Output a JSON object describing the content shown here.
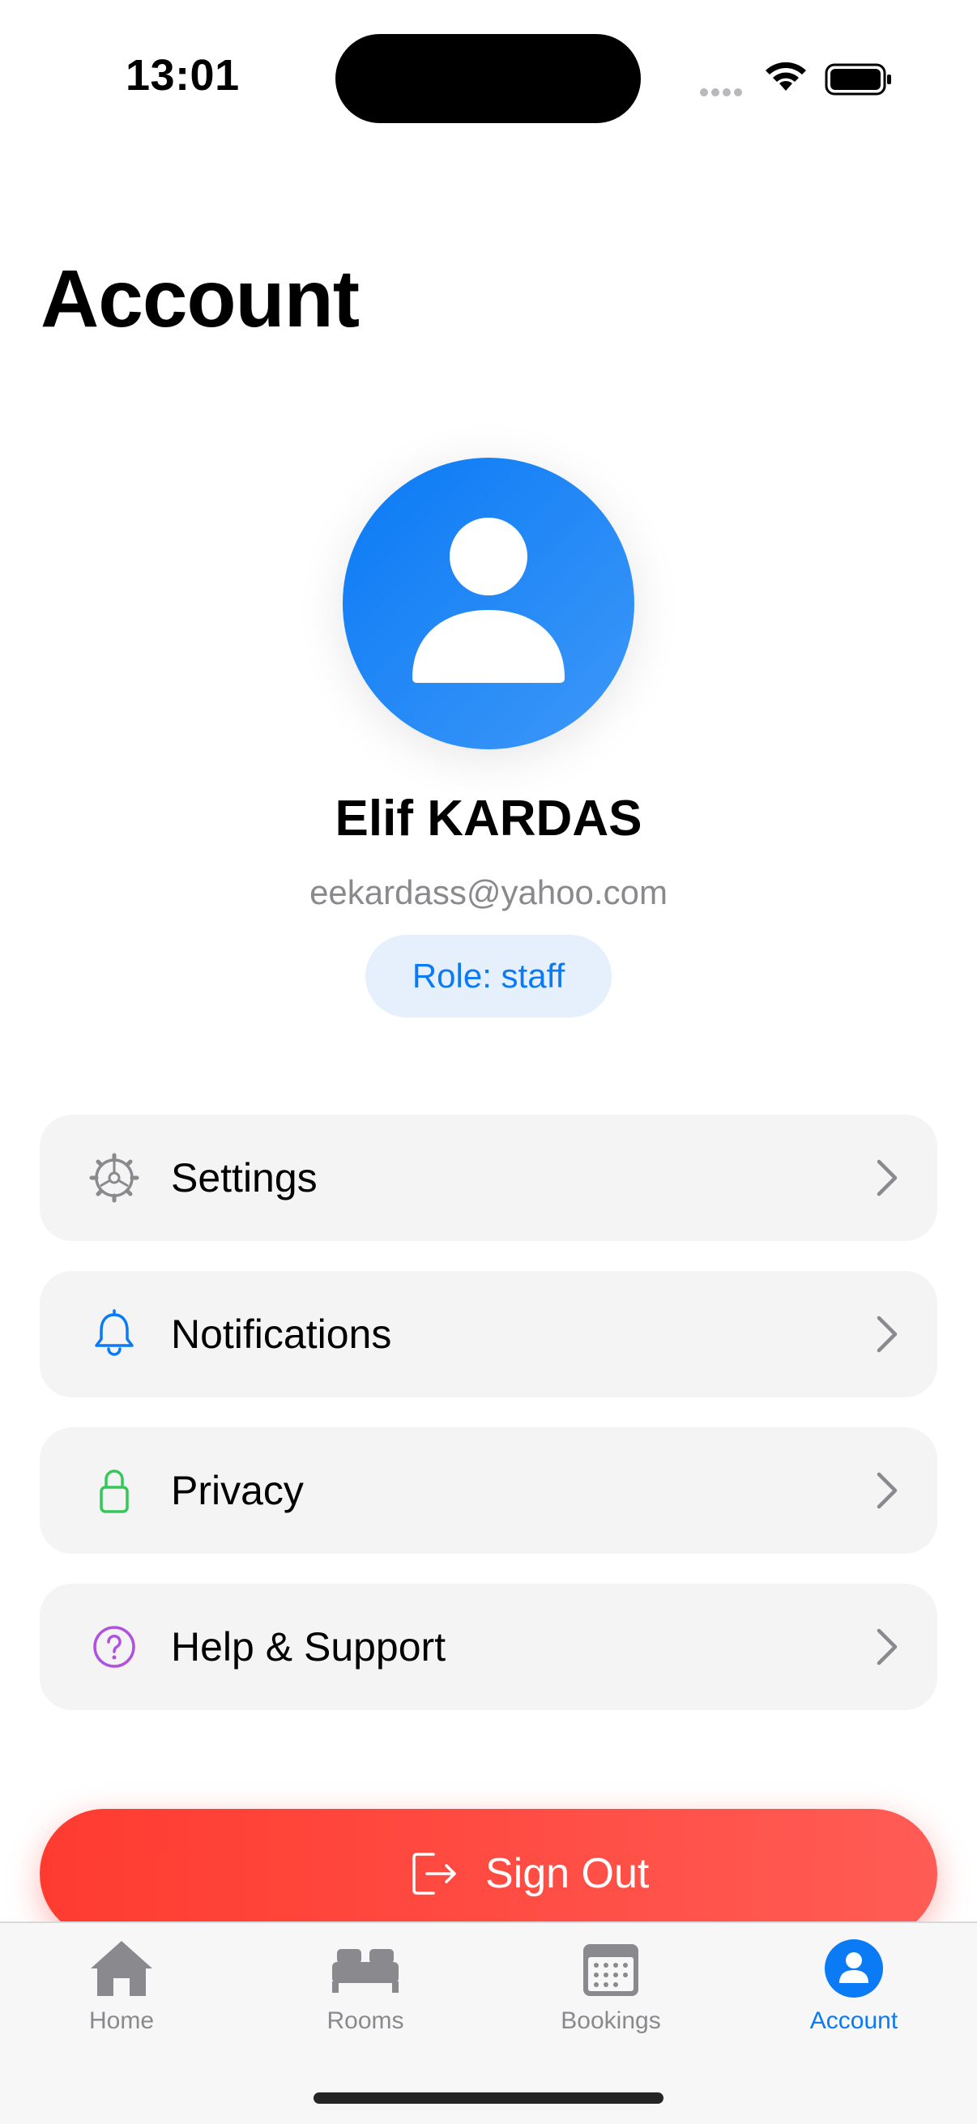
{
  "status_bar": {
    "time": "13:01"
  },
  "page": {
    "title": "Account"
  },
  "profile": {
    "name": "Elif KARDAS",
    "email": "eekardass@yahoo.com",
    "role_badge": "Role: staff"
  },
  "menu": {
    "items": [
      {
        "label": "Settings",
        "icon": "gear-icon",
        "icon_color": "#8a8a8e"
      },
      {
        "label": "Notifications",
        "icon": "bell-icon",
        "icon_color": "#0a7af5"
      },
      {
        "label": "Privacy",
        "icon": "lock-icon",
        "icon_color": "#34c759"
      },
      {
        "label": "Help & Support",
        "icon": "question-circle-icon",
        "icon_color": "#af52de"
      }
    ]
  },
  "signout": {
    "label": "Sign Out",
    "color": "#ff3b30"
  },
  "tabbar": {
    "tabs": [
      {
        "label": "Home",
        "icon": "house-icon"
      },
      {
        "label": "Rooms",
        "icon": "bed-icon"
      },
      {
        "label": "Bookings",
        "icon": "calendar-icon"
      },
      {
        "label": "Account",
        "icon": "person-circle-icon",
        "active": true
      }
    ],
    "active_color": "#0a7af5"
  }
}
